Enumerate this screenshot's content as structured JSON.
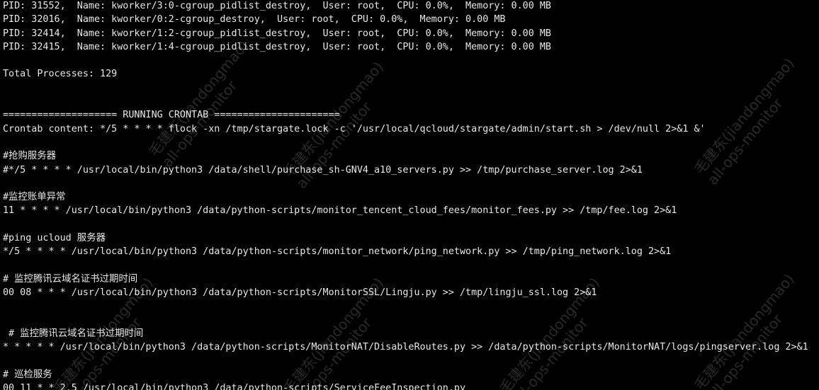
{
  "terminal": {
    "lines": [
      "PID: 31552,  Name: kworker/3:0-cgroup_pidlist_destroy,  User: root,  CPU: 0.0%,  Memory: 0.00 MB",
      "PID: 32016,  Name: kworker/0:2-cgroup_destroy,  User: root,  CPU: 0.0%,  Memory: 0.00 MB",
      "PID: 32414,  Name: kworker/1:2-cgroup_pidlist_destroy,  User: root,  CPU: 0.0%,  Memory: 0.00 MB",
      "PID: 32415,  Name: kworker/1:4-cgroup_pidlist_destroy,  User: root,  CPU: 0.0%,  Memory: 0.00 MB",
      "",
      "Total Processes: 129",
      "",
      "",
      "==================== RUNNING CRONTAB ======================",
      "Crontab content: */5 * * * * flock -xn /tmp/stargate.lock -c '/usr/local/qcloud/stargate/admin/start.sh > /dev/null 2>&1 &'",
      "",
      "#抢购服务器",
      "#*/5 * * * * /usr/local/bin/python3 /data/shell/purchase_sh-GNV4_a10_servers.py >> /tmp/purchase_server.log 2>&1",
      "",
      "#监控账单异常",
      "11 * * * * /usr/local/bin/python3 /data/python-scripts/monitor_tencent_cloud_fees/monitor_fees.py >> /tmp/fee.log 2>&1",
      "",
      "#ping ucloud 服务器",
      "*/5 * * * * /usr/local/bin/python3 /data/python-scripts/monitor_network/ping_network.py >> /tmp/ping_network.log 2>&1",
      "",
      "# 监控腾讯云域名证书过期时间",
      "00 08 * * * /usr/local/bin/python3 /data/python-scripts/MonitorSSL/Lingju.py >> /tmp/lingju_ssl.log 2>&1",
      "",
      "",
      " # 监控腾讯云域名证书过期时间",
      "* * * * * /usr/local/bin/python3 /data/python-scripts/MonitorNAT/DisableRoutes.py >> /data/python-scripts/MonitorNAT/logs/pingserver.log 2>&1",
      "",
      "# 巡检服务",
      "00 11 * * 2,5 /usr/local/bin/python3 /data/python-scripts/ServiceFeeInspection.py"
    ]
  },
  "watermark": {
    "text": "毛建东(jiandongmao)\nall-ops-monitor"
  }
}
